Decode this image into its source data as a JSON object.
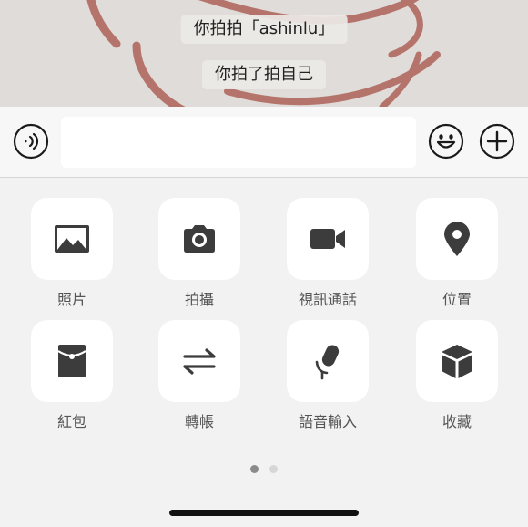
{
  "chat": {
    "system_messages": [
      "你拍拍「ashinlu」",
      "你拍了拍自己"
    ],
    "background_accent": "#b5746b"
  },
  "input_bar": {
    "voice_icon": "voice-icon",
    "emoji_icon": "emoji-icon",
    "plus_icon": "plus-icon",
    "text_value": ""
  },
  "panel": {
    "items": [
      {
        "label": "照片",
        "icon": "image-icon"
      },
      {
        "label": "拍攝",
        "icon": "camera-icon"
      },
      {
        "label": "視訊通話",
        "icon": "video-camera-icon"
      },
      {
        "label": "位置",
        "icon": "location-pin-icon"
      },
      {
        "label": "紅包",
        "icon": "red-envelope-icon"
      },
      {
        "label": "轉帳",
        "icon": "transfer-arrows-icon"
      },
      {
        "label": "語音輸入",
        "icon": "microphone-icon"
      },
      {
        "label": "收藏",
        "icon": "cube-icon"
      }
    ],
    "pages": 2,
    "active_page": 1
  },
  "colors": {
    "icon": "#3c3c3c",
    "panel_bg": "#f2f2f2",
    "tile_bg": "#ffffff"
  }
}
